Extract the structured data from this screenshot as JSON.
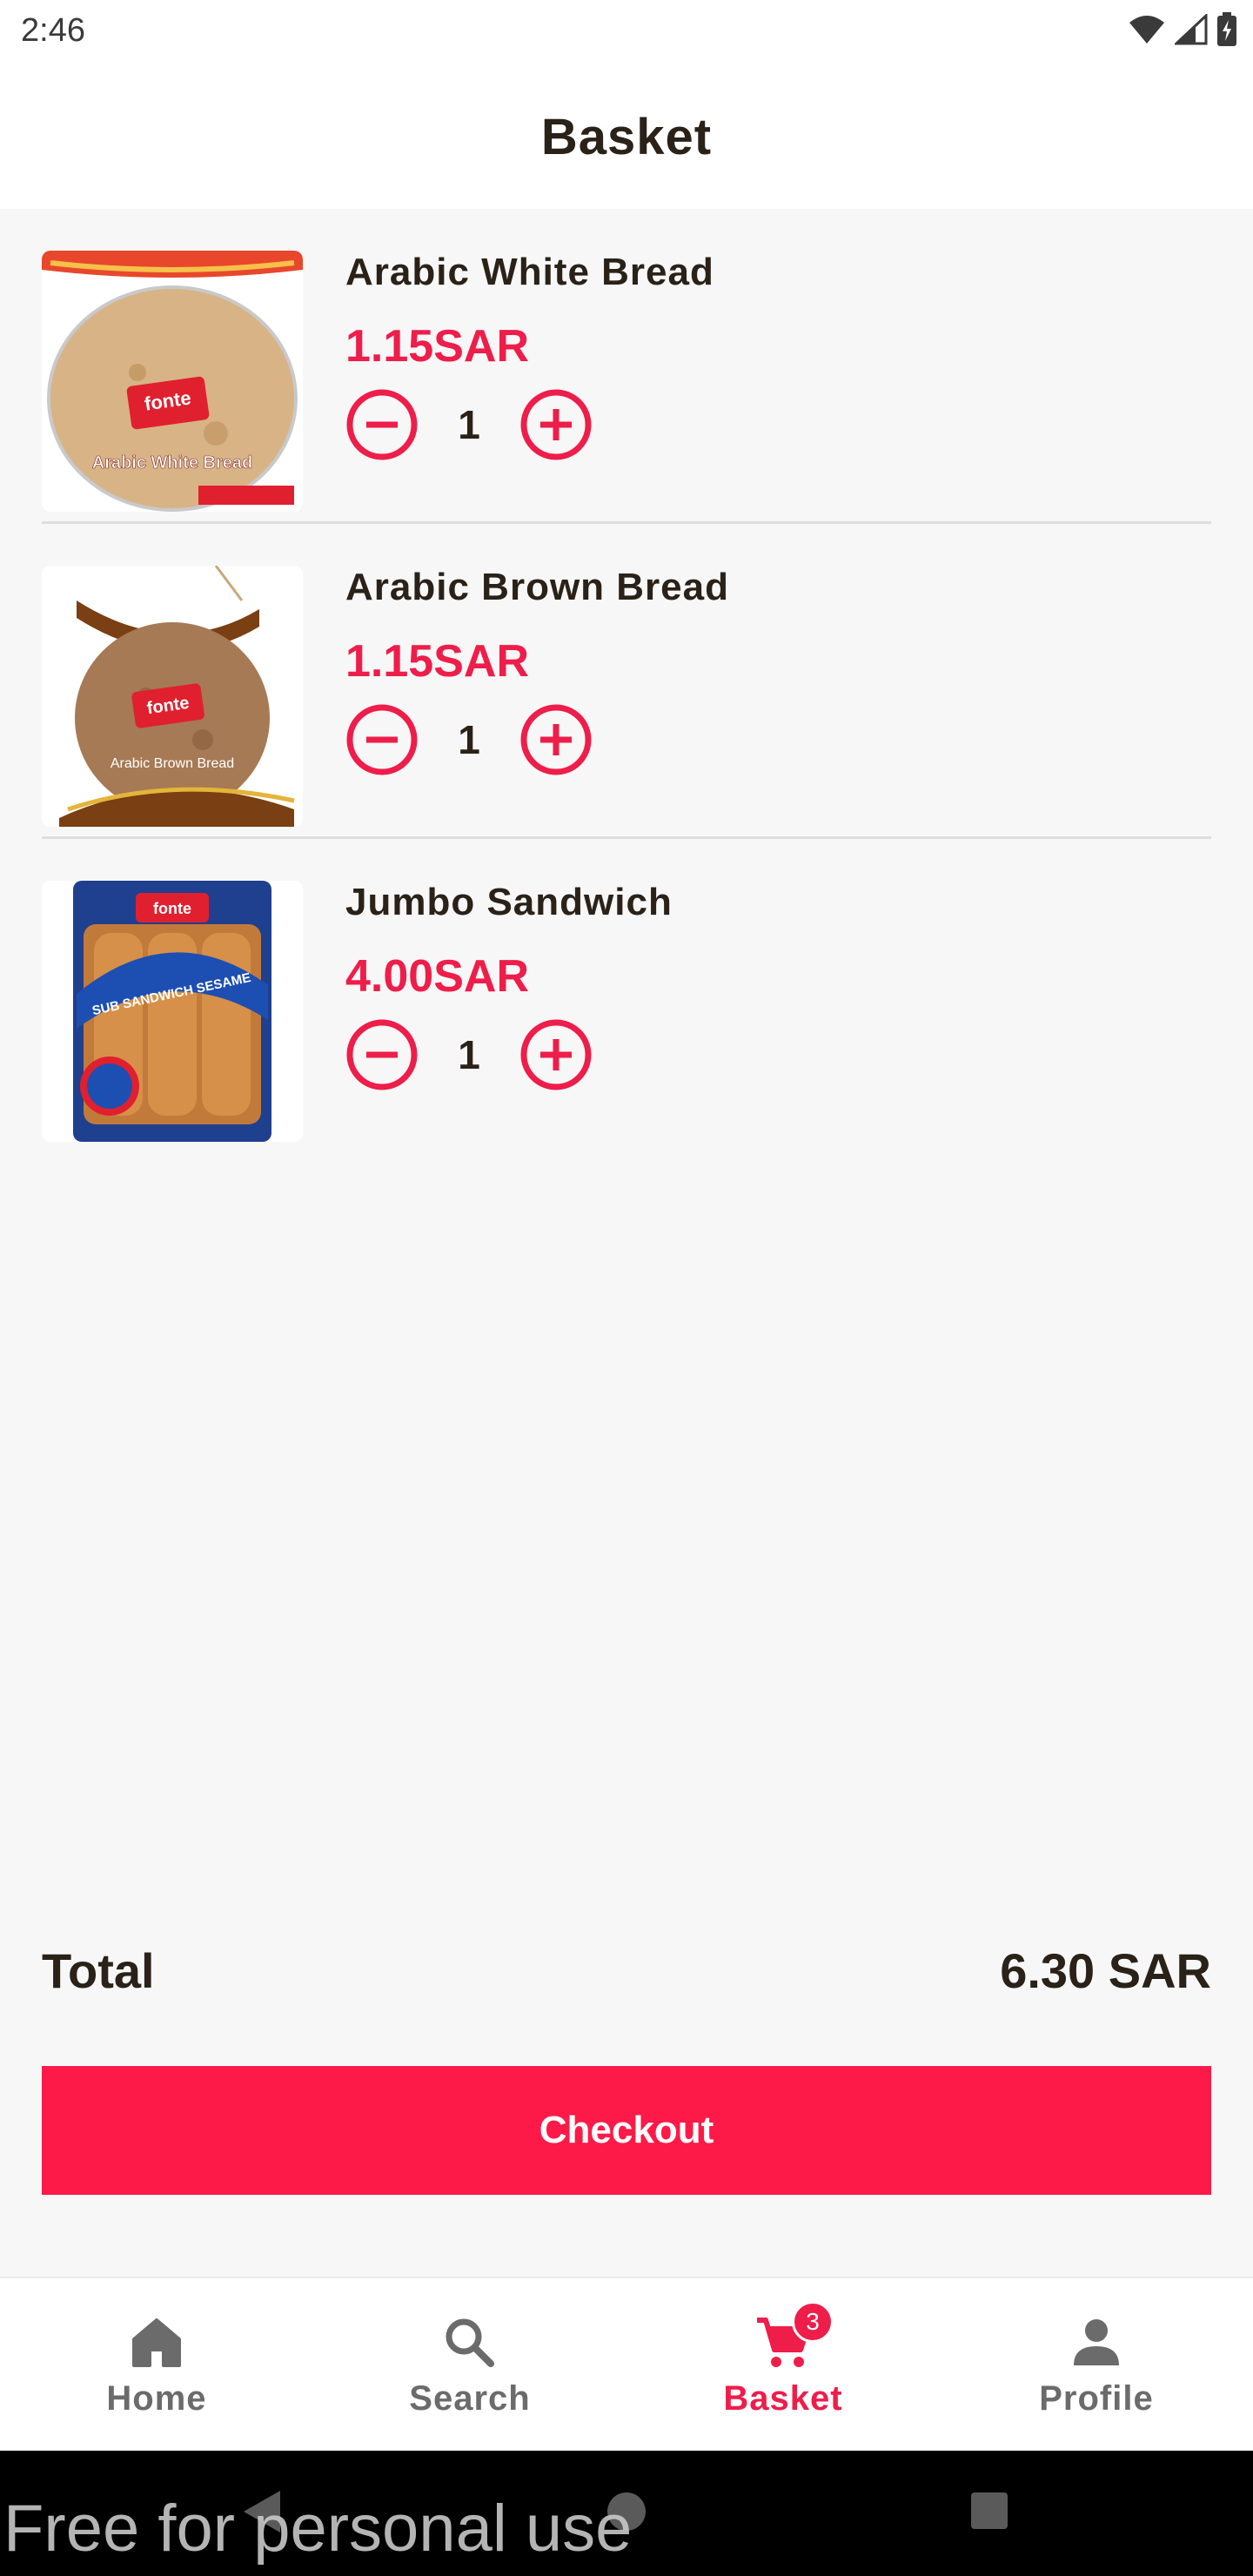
{
  "status_bar": {
    "time": "2:46",
    "icons": [
      "wifi-icon",
      "signal-icon",
      "battery-charging-icon"
    ]
  },
  "header": {
    "title": "Basket"
  },
  "basket": {
    "items": [
      {
        "name": "Arabic White Bread",
        "price": "1.15SAR",
        "quantity": "1",
        "image_label": "Arabic White Bread",
        "brand": "fonte"
      },
      {
        "name": "Arabic Brown Bread",
        "price": "1.15SAR",
        "quantity": "1",
        "image_label": "Arabic Brown Bread",
        "brand": "fonte"
      },
      {
        "name": "Jumbo Sandwich",
        "price": "4.00SAR",
        "quantity": "1",
        "image_label": "SUB SANDWICH SESAME",
        "brand": "fonte"
      }
    ]
  },
  "summary": {
    "total_label": "Total",
    "total_value": "6.30 SAR"
  },
  "checkout": {
    "label": "Checkout"
  },
  "bottom_nav": {
    "items": [
      {
        "label": "Home",
        "icon": "home-icon",
        "active": false
      },
      {
        "label": "Search",
        "icon": "search-icon",
        "active": false
      },
      {
        "label": "Basket",
        "icon": "cart-icon",
        "active": true,
        "badge": "3"
      },
      {
        "label": "Profile",
        "icon": "person-icon",
        "active": false
      }
    ]
  },
  "system_nav": {
    "icons": [
      "back-icon",
      "home-circle-icon",
      "recents-icon"
    ]
  },
  "watermark": {
    "text": "Free for personal use"
  },
  "colors": {
    "accent": "#ee1d4a",
    "checkout_bg": "#fe1a48",
    "text_dark": "#2a2118",
    "background": "#f7f7f7"
  }
}
